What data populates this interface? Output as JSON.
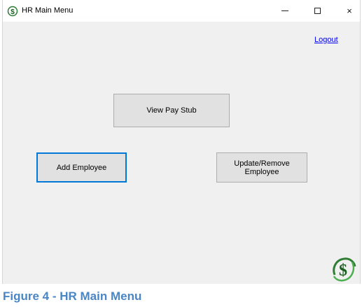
{
  "window": {
    "title": "HR Main Menu"
  },
  "titlebar": {
    "minimize_icon": "minimize-icon",
    "maximize_icon": "maximize-icon",
    "close_glyph": "×"
  },
  "main": {
    "logout_label": "Logout",
    "view_pay_stub_label": "View Pay Stub",
    "add_employee_label": "Add Employee",
    "update_remove_label": "Update/Remove Employee"
  },
  "caption": "Figure 4 - HR Main Menu",
  "colors": {
    "window_bg": "#f0f0f0",
    "button_bg": "#e1e1e1",
    "focus_border": "#0078d7",
    "link": "#0000ee",
    "logo_green": "#2e7d32",
    "caption": "#4a86c5"
  }
}
